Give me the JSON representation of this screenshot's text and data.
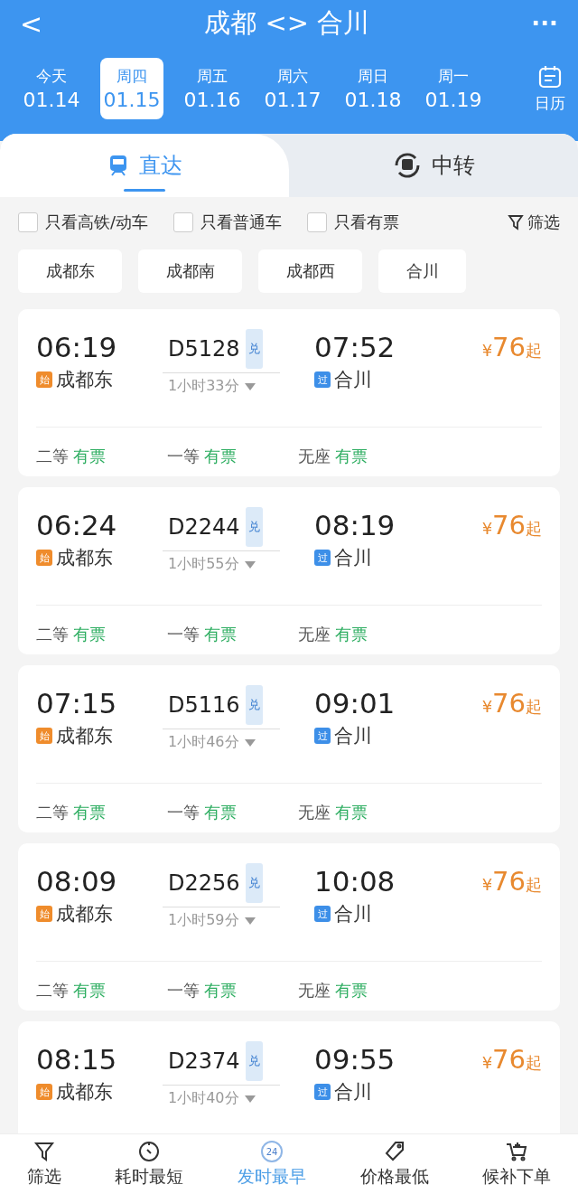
{
  "header": {
    "back": "<",
    "title": "成都 <> 合川",
    "more": "···"
  },
  "dates": [
    {
      "weekday": "今天",
      "date": "01.14",
      "selected": false
    },
    {
      "weekday": "周四",
      "date": "01.15",
      "selected": true
    },
    {
      "weekday": "周五",
      "date": "01.16",
      "selected": false
    },
    {
      "weekday": "周六",
      "date": "01.17",
      "selected": false
    },
    {
      "weekday": "周日",
      "date": "01.18",
      "selected": false
    },
    {
      "weekday": "周一",
      "date": "01.19",
      "selected": false
    }
  ],
  "calendar": "日历",
  "mode_tabs": [
    {
      "label": "直达",
      "selected": true
    },
    {
      "label": "中转",
      "selected": false
    }
  ],
  "filters": [
    {
      "label": "只看高铁/动车",
      "checked": false
    },
    {
      "label": "只看普通车",
      "checked": false
    },
    {
      "label": "只看有票",
      "checked": false
    }
  ],
  "filter_button": "筛选",
  "stations": [
    "成都东",
    "成都南",
    "成都西",
    "合川"
  ],
  "trains": [
    {
      "depart": "06:19",
      "from_tag": "始",
      "from": "成都东",
      "number": "D5128",
      "badge": "兑",
      "duration": "1小时33分",
      "arrive": "07:52",
      "to_tag": "过",
      "to": "合川",
      "currency": "¥",
      "price": "76",
      "price_suffix": "起",
      "seats": [
        {
          "class": "二等",
          "status": "有票"
        },
        {
          "class": "一等",
          "status": "有票"
        },
        {
          "class": "无座",
          "status": "有票"
        }
      ]
    },
    {
      "depart": "06:24",
      "from_tag": "始",
      "from": "成都东",
      "number": "D2244",
      "badge": "兑",
      "duration": "1小时55分",
      "arrive": "08:19",
      "to_tag": "过",
      "to": "合川",
      "currency": "¥",
      "price": "76",
      "price_suffix": "起",
      "seats": [
        {
          "class": "二等",
          "status": "有票"
        },
        {
          "class": "一等",
          "status": "有票"
        },
        {
          "class": "无座",
          "status": "有票"
        }
      ]
    },
    {
      "depart": "07:15",
      "from_tag": "始",
      "from": "成都东",
      "number": "D5116",
      "badge": "兑",
      "duration": "1小时46分",
      "arrive": "09:01",
      "to_tag": "过",
      "to": "合川",
      "currency": "¥",
      "price": "76",
      "price_suffix": "起",
      "seats": [
        {
          "class": "二等",
          "status": "有票"
        },
        {
          "class": "一等",
          "status": "有票"
        },
        {
          "class": "无座",
          "status": "有票"
        }
      ]
    },
    {
      "depart": "08:09",
      "from_tag": "始",
      "from": "成都东",
      "number": "D2256",
      "badge": "兑",
      "duration": "1小时59分",
      "arrive": "10:08",
      "to_tag": "过",
      "to": "合川",
      "currency": "¥",
      "price": "76",
      "price_suffix": "起",
      "seats": [
        {
          "class": "二等",
          "status": "有票"
        },
        {
          "class": "一等",
          "status": "有票"
        },
        {
          "class": "无座",
          "status": "有票"
        }
      ]
    },
    {
      "depart": "08:15",
      "from_tag": "始",
      "from": "成都东",
      "number": "D2374",
      "badge": "兑",
      "duration": "1小时40分",
      "arrive": "09:55",
      "to_tag": "过",
      "to": "合川",
      "currency": "¥",
      "price": "76",
      "price_suffix": "起"
    }
  ],
  "bottom_bar": [
    {
      "kind": "filter",
      "label": "筛选",
      "selected": false
    },
    {
      "kind": "timer",
      "label": "耗时最短",
      "selected": false
    },
    {
      "kind": "clock24",
      "label": "发时最早",
      "icon_text": "24",
      "selected": true
    },
    {
      "kind": "tag",
      "label": "价格最低",
      "selected": false
    },
    {
      "kind": "cart",
      "label": "候补下单",
      "selected": false
    }
  ]
}
